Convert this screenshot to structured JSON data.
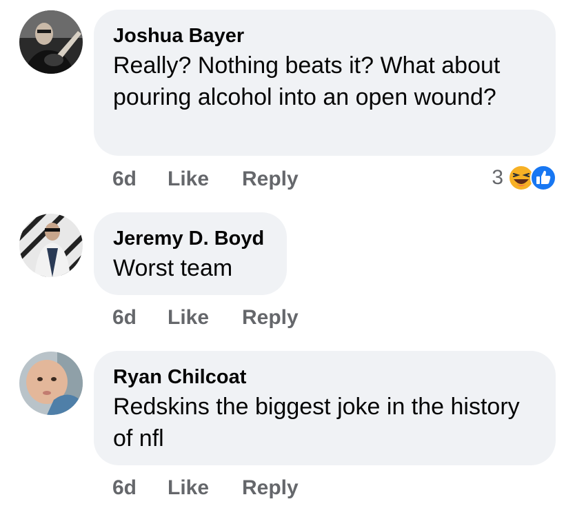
{
  "comments": [
    {
      "author": "Joshua Bayer",
      "text": "Really?  Nothing beats it?  What about pouring alcohol into an open wound?",
      "time": "6d",
      "like": "Like",
      "reply": "Reply",
      "reaction_count": "3",
      "reaction_icons": [
        "haha-icon",
        "like-icon"
      ]
    },
    {
      "author": "Jeremy D. Boyd",
      "text": "Worst team",
      "time": "6d",
      "like": "Like",
      "reply": "Reply"
    },
    {
      "author": "Ryan Chilcoat",
      "text": "Redskins the biggest joke in the history of nfl",
      "time": "6d",
      "like": "Like",
      "reply": "Reply"
    }
  ],
  "colors": {
    "bubble": "#f0f2f5",
    "meta": "#65676b",
    "like_blue": "#1877f2",
    "haha_yellow": "#f7b125"
  }
}
